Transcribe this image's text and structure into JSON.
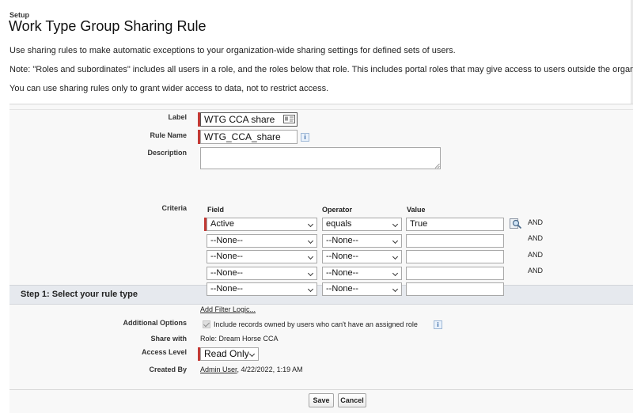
{
  "breadcrumb": "Setup",
  "page_title": "Work Type Group Sharing Rule",
  "intro": [
    "Use sharing rules to make automatic exceptions to your organization-wide sharing settings for defined sets of users.",
    "Note: \"Roles and subordinates\" includes all users in a role, and the roles below that role. This includes portal roles that may give access to users outside the organization.",
    "You can use sharing rules only to grant wider access to data, not to restrict access."
  ],
  "form": {
    "label_label": "Label",
    "label_value": "WTG CCA share",
    "rule_name_label": "Rule Name",
    "rule_name_value": "WTG_CCA_share",
    "description_label": "Description",
    "description_value": ""
  },
  "step1": {
    "title": "Step 1: Select your rule type",
    "criteria_label": "Criteria",
    "columns": {
      "field": "Field",
      "operator": "Operator",
      "value": "Value"
    },
    "rows": [
      {
        "field": "Active",
        "operator": "equals",
        "value": "True",
        "conj": "AND"
      },
      {
        "field": "--None--",
        "operator": "--None--",
        "value": "",
        "conj": "AND"
      },
      {
        "field": "--None--",
        "operator": "--None--",
        "value": "",
        "conj": "AND"
      },
      {
        "field": "--None--",
        "operator": "--None--",
        "value": "",
        "conj": "AND"
      },
      {
        "field": "--None--",
        "operator": "--None--",
        "value": "",
        "conj": ""
      }
    ],
    "add_filter_logic": "Add Filter Logic...",
    "additional_options_label": "Additional Options",
    "additional_option_text": "Include records owned by users who can't have an assigned role",
    "additional_option_checked": true,
    "share_with_label": "Share with",
    "share_with_value": "Role: Dream Horse CCA",
    "access_level_label": "Access Level",
    "access_level_value": "Read Only",
    "created_by_label": "Created By",
    "created_by_user": "Admin User",
    "created_by_date": ", 4/22/2022, 1:19 AM"
  },
  "buttons": {
    "save": "Save",
    "cancel": "Cancel"
  },
  "icons": {
    "info": "i",
    "lookup": "lookup-icon",
    "card": "contact-card-icon"
  },
  "colors": {
    "required": "#c23934",
    "section_bg": "#e6e9ee",
    "panel_bg": "#f8f8f8"
  }
}
